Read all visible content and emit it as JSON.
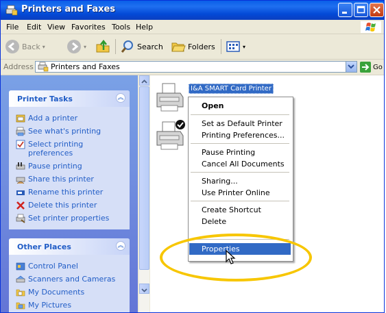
{
  "window": {
    "title": "Printers and Faxes"
  },
  "menubar": {
    "items": [
      "File",
      "Edit",
      "View",
      "Favorites",
      "Tools",
      "Help"
    ]
  },
  "toolbar": {
    "back_label": "Back",
    "search_label": "Search",
    "folders_label": "Folders"
  },
  "address": {
    "label": "Address",
    "value": "Printers and Faxes",
    "go_label": "Go"
  },
  "printer_tasks": {
    "title": "Printer Tasks",
    "items": [
      {
        "label": "Add a printer",
        "icon": "add-printer-icon"
      },
      {
        "label": "See what's printing",
        "icon": "printer-queue-icon"
      },
      {
        "label": "Select printing preferences",
        "icon": "preferences-icon"
      },
      {
        "label": "Pause printing",
        "icon": "pause-printer-icon"
      },
      {
        "label": "Share this printer",
        "icon": "share-printer-icon"
      },
      {
        "label": "Rename this printer",
        "icon": "rename-icon"
      },
      {
        "label": "Delete this printer",
        "icon": "delete-x-icon"
      },
      {
        "label": "Set printer properties",
        "icon": "printer-properties-icon"
      }
    ]
  },
  "other_places": {
    "title": "Other Places",
    "items": [
      {
        "label": "Control Panel",
        "icon": "control-panel-icon"
      },
      {
        "label": "Scanners and Cameras",
        "icon": "scanner-icon"
      },
      {
        "label": "My Documents",
        "icon": "folder-icon"
      },
      {
        "label": "My Pictures",
        "icon": "pictures-folder-icon"
      }
    ]
  },
  "content": {
    "selected_printer_label": "I&A SMART Card Printer"
  },
  "context_menu": {
    "items": [
      "Open",
      "Set as Default Printer",
      "Printing Preferences...",
      "Pause Printing",
      "Cancel All Documents",
      "Sharing...",
      "Use Printer Online",
      "Create Shortcut",
      "Delete",
      "Properties"
    ]
  },
  "colors": {
    "titlebar": "#0a5fe8",
    "selection": "#316ac5",
    "highlight_ring": "#f7c600",
    "task_link": "#215dc6"
  }
}
